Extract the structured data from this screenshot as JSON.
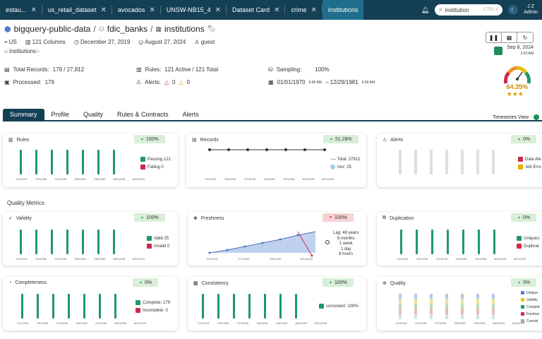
{
  "tabs": [
    {
      "label": "estau..."
    },
    {
      "label": "us_retail_dataset"
    },
    {
      "label": "avocados"
    },
    {
      "label": "UNSW-NB15_4"
    },
    {
      "label": "Dataset Card"
    },
    {
      "label": "crime"
    },
    {
      "label": "institutions"
    }
  ],
  "search": {
    "value": "institution",
    "shortcut": "CTRL K"
  },
  "user": {
    "initials": "J Z",
    "role": "Admin"
  },
  "breadcrumb": {
    "project": "bigquery-public-data",
    "dataset": "fdic_banks",
    "table": "institutions"
  },
  "meta": {
    "region": "US",
    "columns": "121 Columns",
    "created": "December 27, 2019",
    "modified": "August 27, 2024",
    "owner": "guest",
    "tag": "institutions:-"
  },
  "top_right": {
    "date": "Sep 8, 2024",
    "time": "2:42 AM"
  },
  "stats": {
    "total_records_label": "Total Records:",
    "total_records": "179 / 27,812",
    "processed_label": "Processed:",
    "processed": "179",
    "rules_label": "Rules:",
    "rules": "121 Active / 121 Total",
    "alerts_label": "Alerts:",
    "alerts_red": "0",
    "alerts_yellow": "0",
    "sampling_label": "Sampling:",
    "sampling": "100%",
    "date_range": "01/01/1970",
    "date_range_t1": "6:00 AM",
    "date_range_sep": "– 12/29/1981",
    "date_range_t2": "6:00 AM"
  },
  "score": {
    "value": "64.35%",
    "stars": "★★★",
    "gauge_fraction": 0.64
  },
  "nav": {
    "tabs": [
      "Summary",
      "Profile",
      "Quality",
      "Rules & Contracts",
      "Alerts"
    ],
    "timeseries_label": "Timeseries View :"
  },
  "section_quality": "Quality Metrics",
  "dates": [
    "7/1/12/31",
    "7/9/12/30",
    "7/7/12/30",
    "7/8/12/30",
    "7/9/12/30",
    "8/0/12/29",
    "8/1/12/29"
  ],
  "cards": {
    "rules": {
      "title": "Rules",
      "badge": "100%",
      "legend": [
        "Passing  121",
        "Failing  0"
      ]
    },
    "records": {
      "title": "Records",
      "badge": "51.28%",
      "legend": [
        "Total: 27812",
        "Incr: 25"
      ]
    },
    "alerts": {
      "title": "Alerts",
      "badge": "0%",
      "legend": [
        "Data Ale",
        "Job Erro"
      ]
    },
    "validity": {
      "title": "Validity",
      "badge": "100%",
      "legend": [
        "Valid 25",
        "Invalid 0"
      ]
    },
    "freshness": {
      "title": "Freshness",
      "badge": "100%",
      "legend": [
        "Lag: 48 years",
        "8 months",
        "1 week",
        "1 day",
        "8 hours"
      ],
      "dates": [
        "7/1/12/31",
        "7/7/12/30",
        "7/9/12/30",
        "8/1/12/29"
      ]
    },
    "duplication": {
      "title": "Duplication",
      "badge": "0%",
      "legend": [
        "Uniques:",
        "Duplicat"
      ]
    },
    "completeness": {
      "title": "Completeness",
      "badge": "0%",
      "legend": [
        "Complete: 179",
        "Incomplete: 0"
      ]
    },
    "consistency": {
      "title": "Consistency",
      "badge": "100%",
      "legend": [
        "consistent: 100%"
      ]
    },
    "quality": {
      "title": "Quality",
      "badge": "0%",
      "legend": [
        "Unique",
        "Validity",
        "Complet",
        "Freshne",
        "Consist"
      ]
    }
  },
  "colors": {
    "green": "#1e9966",
    "red": "#d0284a",
    "yellow": "#e8b000",
    "navy": "#143f55",
    "teal": "#1f6e8c"
  }
}
